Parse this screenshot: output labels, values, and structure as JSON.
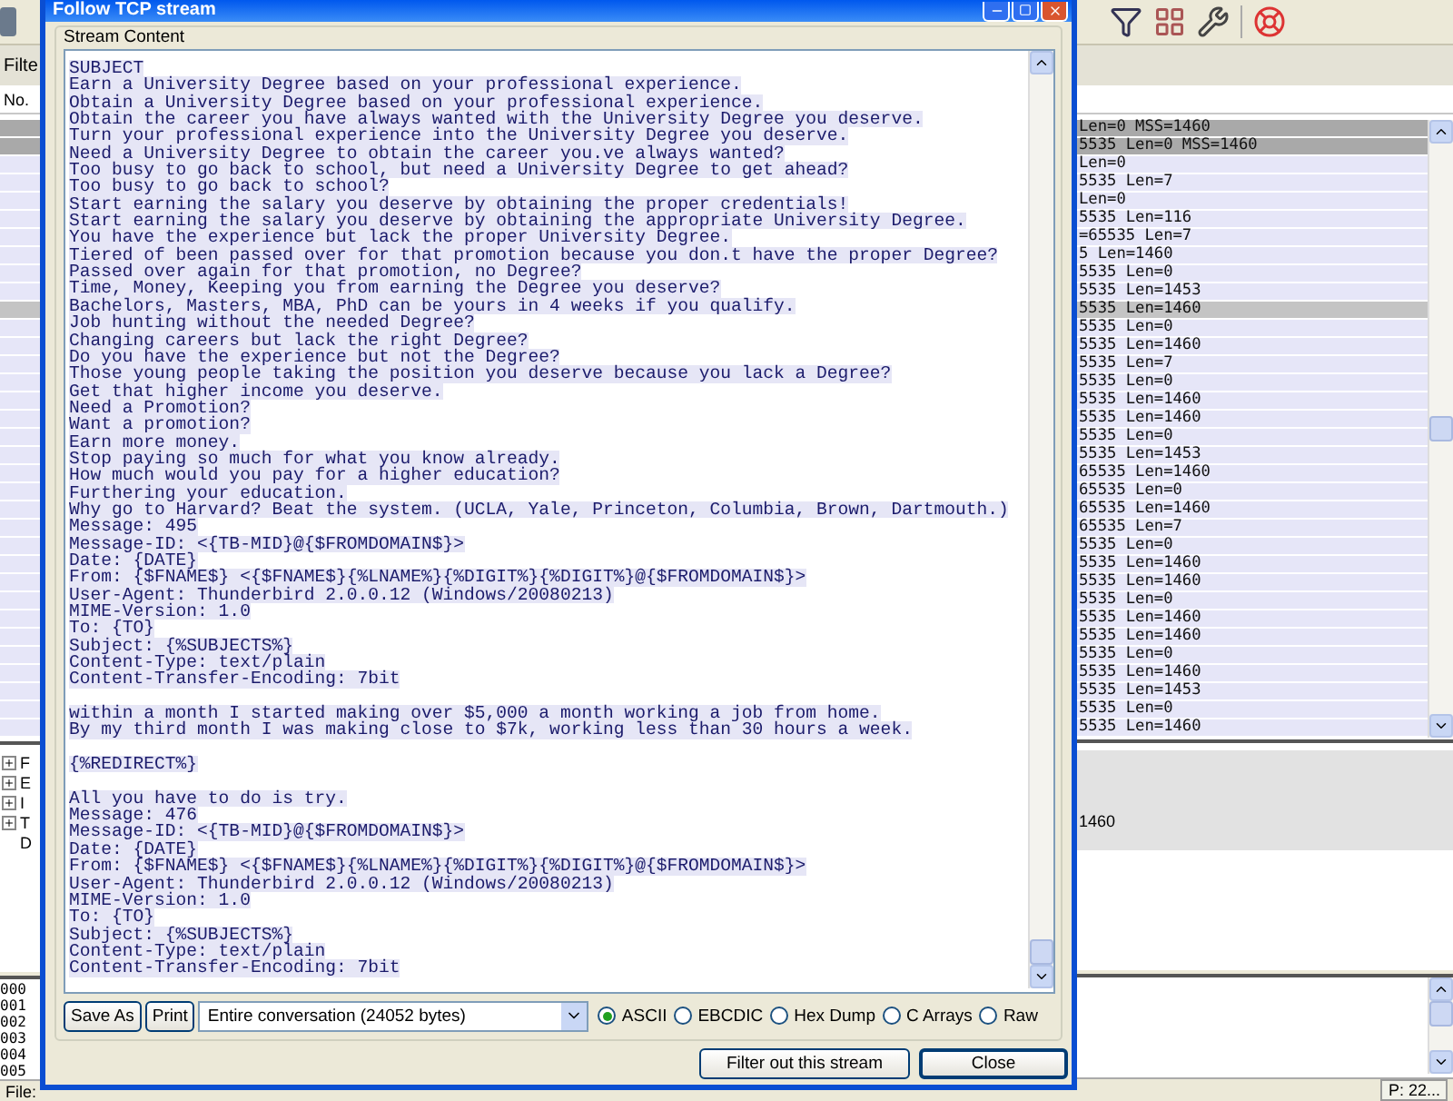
{
  "background_window": {
    "filter_label": "Filte",
    "packet_list": {
      "header": "No.",
      "rows": [
        {
          "info": "Len=0 MSS=1460",
          "color": "#a9a9a9"
        },
        {
          "info": "5535 Len=0 MSS=1460",
          "color": "#a9a9a9"
        },
        {
          "info": "Len=0",
          "color": "#e6e6f8"
        },
        {
          "info": "5535 Len=7",
          "color": "#e6e6f8"
        },
        {
          "info": "Len=0",
          "color": "#e6e6f8"
        },
        {
          "info": "5535 Len=116",
          "color": "#e6e6f8"
        },
        {
          "info": "=65535 Len=7",
          "color": "#e6e6f8"
        },
        {
          "info": "5 Len=1460",
          "color": "#e6e6f8"
        },
        {
          "info": "5535 Len=0",
          "color": "#e6e6f8"
        },
        {
          "info": "5535 Len=1453",
          "color": "#e6e6f8"
        },
        {
          "info": "5535 Len=1460",
          "color": "#c4c4c4"
        },
        {
          "info": "5535 Len=0",
          "color": "#e6e6f8"
        },
        {
          "info": "5535 Len=1460",
          "color": "#e6e6f8"
        },
        {
          "info": "5535 Len=7",
          "color": "#e6e6f8"
        },
        {
          "info": "5535 Len=0",
          "color": "#e6e6f8"
        },
        {
          "info": "5535 Len=1460",
          "color": "#e6e6f8"
        },
        {
          "info": "5535 Len=1460",
          "color": "#e6e6f8"
        },
        {
          "info": "5535 Len=0",
          "color": "#e6e6f8"
        },
        {
          "info": "5535 Len=1453",
          "color": "#e6e6f8"
        },
        {
          "info": "65535 Len=1460",
          "color": "#e6e6f8"
        },
        {
          "info": "65535 Len=0",
          "color": "#e6e6f8"
        },
        {
          "info": "65535 Len=1460",
          "color": "#e6e6f8"
        },
        {
          "info": "65535 Len=7",
          "color": "#e6e6f8"
        },
        {
          "info": "5535 Len=0",
          "color": "#e6e6f8"
        },
        {
          "info": "5535 Len=1460",
          "color": "#e6e6f8"
        },
        {
          "info": "5535 Len=1460",
          "color": "#e6e6f8"
        },
        {
          "info": "5535 Len=0",
          "color": "#e6e6f8"
        },
        {
          "info": "5535 Len=1460",
          "color": "#e6e6f8"
        },
        {
          "info": "5535 Len=1460",
          "color": "#e6e6f8"
        },
        {
          "info": "5535 Len=0",
          "color": "#e6e6f8"
        },
        {
          "info": "5535 Len=1460",
          "color": "#e6e6f8"
        },
        {
          "info": "5535 Len=1453",
          "color": "#e6e6f8"
        },
        {
          "info": "5535 Len=0",
          "color": "#e6e6f8"
        },
        {
          "info": "5535 Len=1460",
          "color": "#e6e6f8"
        }
      ]
    },
    "tree": [
      {
        "kind": "branch",
        "label": "F",
        "expanded": false
      },
      {
        "kind": "branch",
        "label": "E",
        "expanded": false
      },
      {
        "kind": "branch",
        "label": "I",
        "expanded": false
      },
      {
        "kind": "branch",
        "label": "T",
        "expanded": false,
        "tail": "1460"
      },
      {
        "kind": "leaf",
        "label": "D"
      }
    ],
    "byte_offsets": [
      "000",
      "001",
      "002",
      "003",
      "004",
      "005"
    ],
    "status_bar": {
      "left": "File:",
      "right": "P: 22..."
    }
  },
  "dialog": {
    "title": "Follow TCP stream",
    "group_label": "Stream Content",
    "stream_blocks": [
      [
        "SUBJECT",
        "Earn a University Degree based on your professional experience.",
        "Obtain a University Degree based on your professional experience.",
        "Obtain the career you have always wanted with the University Degree you deserve.",
        "Turn your professional experience into the University Degree you deserve.",
        "Need a University Degree to obtain the career you.ve always wanted?",
        "Too busy to go back to school, but need a University Degree to get ahead?",
        "Too busy to go back to school?",
        "Start earning the salary you deserve by obtaining the proper credentials!",
        "Start earning the salary you deserve by obtaining the appropriate University Degree.",
        "You have the experience but lack the proper University Degree.",
        "Tiered of been passed over for that promotion because you don.t have the proper Degree?",
        "Passed over again for that promotion, no Degree?",
        "Time, Money, Keeping you from earning the Degree you deserve?",
        "Bachelors, Masters, MBA, PhD can be yours in 4 weeks if you qualify.",
        "Job hunting without the needed Degree?",
        "Changing careers but lack the right Degree?",
        "Do you have the experience but not the Degree?",
        "Those young people taking the position you deserve because you lack a Degree?",
        "Get that higher income you deserve.",
        "Need a Promotion?",
        "Want a promotion?",
        "Earn more money.",
        "Stop paying so much for what you know already.",
        "How much would you pay for a higher education?",
        "Furthering your education.",
        "Why go to Harvard? Beat the system. (UCLA, Yale, Princeton, Columbia, Brown, Dartmouth.)",
        "Message: 495",
        "Message-ID: <{TB-MID}@{$FROMDOMAIN$}>",
        "Date: {DATE}",
        "From: {$FNAME$} <{$FNAME$}{%LNAME%}{%DIGIT%}{%DIGIT%}@{$FROMDOMAIN$}>",
        "User-Agent: Thunderbird 2.0.0.12 (Windows/20080213)",
        "MIME-Version: 1.0",
        "To: {TO}",
        "Subject: {%SUBJECTS%}",
        "Content-Type: text/plain",
        "Content-Transfer-Encoding: 7bit"
      ],
      [
        "within a month I started making over $5,000 a month working a job from home.",
        "By my third month I was making close to $7k, working less than 30 hours a week."
      ],
      [
        "{%REDIRECT%}"
      ],
      [
        "All you have to do is try.",
        "Message: 476",
        "Message-ID: <{TB-MID}@{$FROMDOMAIN$}>",
        "Date: {DATE}",
        "From: {$FNAME$} <{$FNAME$}{%LNAME%}{%DIGIT%}{%DIGIT%}@{$FROMDOMAIN$}>",
        "User-Agent: Thunderbird 2.0.0.12 (Windows/20080213)",
        "MIME-Version: 1.0",
        "To: {TO}",
        "Subject: {%SUBJECTS%}",
        "Content-Type: text/plain",
        "Content-Transfer-Encoding: 7bit"
      ]
    ],
    "save_as": "Save As",
    "print": "Print",
    "conversation": "Entire conversation (24052 bytes)",
    "formats": [
      {
        "label": "ASCII",
        "selected": true
      },
      {
        "label": "EBCDIC",
        "selected": false
      },
      {
        "label": "Hex Dump",
        "selected": false
      },
      {
        "label": "C Arrays",
        "selected": false
      },
      {
        "label": "Raw",
        "selected": false
      }
    ],
    "buttons": [
      "Filter out this stream",
      "Close"
    ]
  }
}
